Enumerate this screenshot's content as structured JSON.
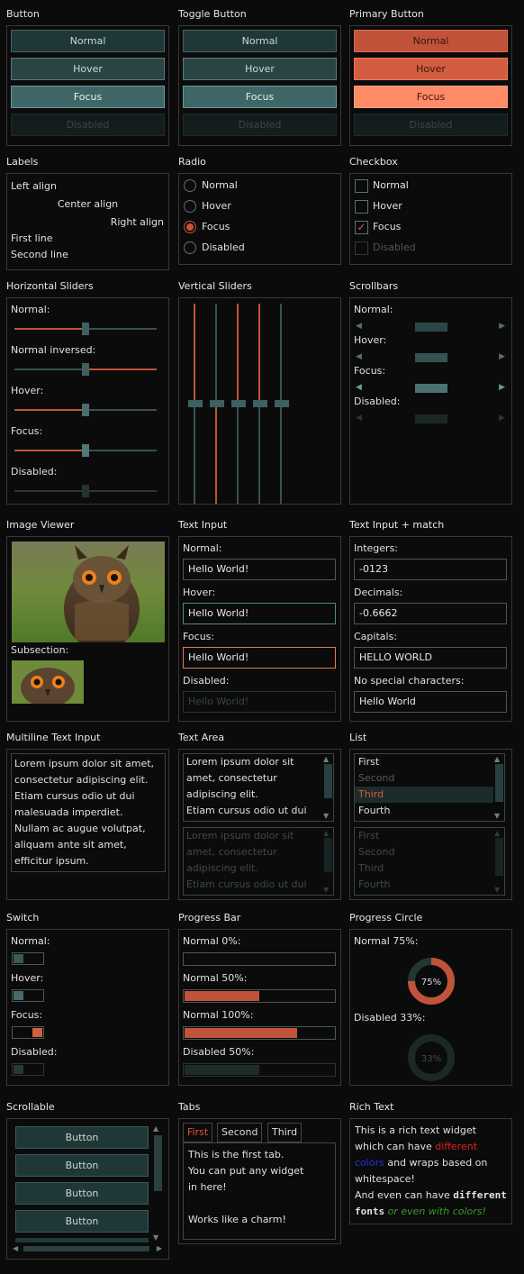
{
  "sections": {
    "button": "Button",
    "toggle_button": "Toggle Button",
    "primary_button": "Primary Button",
    "labels": "Labels",
    "radio": "Radio",
    "checkbox": "Checkbox",
    "hsliders": "Horizontal Sliders",
    "vsliders": "Vertical Sliders",
    "scrollbars": "Scrollbars",
    "image_viewer": "Image Viewer",
    "text_input": "Text Input",
    "text_input_match": "Text Input + match",
    "multiline": "Multiline Text Input",
    "text_area": "Text Area",
    "list": "List",
    "switch": "Switch",
    "progress_bar": "Progress Bar",
    "progress_circle": "Progress Circle",
    "scrollable": "Scrollable",
    "tabs": "Tabs",
    "rich_text": "Rich Text"
  },
  "button_states": [
    "Normal",
    "Hover",
    "Focus",
    "Disabled"
  ],
  "labels": {
    "left": "Left align",
    "center": "Center align",
    "right": "Right align",
    "first": "First line",
    "second": "Second line"
  },
  "radio": [
    "Normal",
    "Hover",
    "Focus",
    "Disabled"
  ],
  "checkbox": [
    "Normal",
    "Hover",
    "Focus",
    "Disabled"
  ],
  "hsliders": [
    {
      "label": "Normal:",
      "value": 0.5,
      "inversed": false
    },
    {
      "label": "Normal inversed:",
      "value": 0.5,
      "inversed": true
    },
    {
      "label": "Hover:",
      "value": 0.5,
      "inversed": false
    },
    {
      "label": "Focus:",
      "value": 0.5,
      "inversed": false
    },
    {
      "label": "Disabled:",
      "value": 0.5,
      "inversed": false
    }
  ],
  "vsliders": [
    {
      "value": 0.5,
      "inversed": false
    },
    {
      "value": 0.5,
      "inversed": true
    },
    {
      "value": 0.5,
      "inversed": false
    },
    {
      "value": 0.5,
      "inversed": false
    },
    {
      "value": 0.5,
      "inversed": false
    }
  ],
  "scrollbars": [
    "Normal:",
    "Hover:",
    "Focus:",
    "Disabled:"
  ],
  "image_viewer": {
    "subsection": "Subsection:"
  },
  "text_input": {
    "labels": [
      "Normal:",
      "Hover:",
      "Focus:",
      "Disabled:"
    ],
    "value": "Hello World!"
  },
  "text_input_match": {
    "labels": [
      "Integers:",
      "Decimals:",
      "Capitals:",
      "No special characters:"
    ],
    "values": [
      "-0123",
      "-0.6662",
      "HELLO WORLD",
      "Hello World"
    ]
  },
  "multiline_lines": [
    "Lorem ipsum dolor sit amet,",
    "consectetur adipiscing elit.",
    "Etiam cursus odio ut dui",
    "malesuada imperdiet.",
    "Nullam ac augue volutpat,",
    "aliquam ante sit amet,",
    "efficitur ipsum."
  ],
  "text_area_lines": [
    "Lorem ipsum dolor sit",
    "amet, consectetur",
    "adipiscing elit.",
    "Etiam cursus odio ut dui"
  ],
  "list_items": [
    "First",
    "Second",
    "Third",
    "Fourth"
  ],
  "switch_labels": [
    "Normal:",
    "Hover:",
    "Focus:",
    "Disabled:"
  ],
  "progress_bar": [
    {
      "label": "Normal 0%:",
      "value": 0.0
    },
    {
      "label": "Normal 50%:",
      "value": 0.5
    },
    {
      "label": "Normal 100%:",
      "value": 0.75
    },
    {
      "label": "Disabled 50%:",
      "value": 0.5
    }
  ],
  "progress_circle": [
    {
      "label": "Normal 75%:",
      "text": "75%",
      "value": 0.75
    },
    {
      "label": "Disabled 33%:",
      "text": "33%",
      "value": 0.33
    }
  ],
  "scrollable_buttons": [
    "Button",
    "Button",
    "Button",
    "Button"
  ],
  "tabs": {
    "names": [
      "First",
      "Second",
      "Third"
    ],
    "content": [
      "This is the first tab.",
      "You can put any widget",
      "in here!",
      "",
      "Works like a charm!"
    ]
  },
  "rich_text": {
    "l1": "This is a rich text widget",
    "l2a": "which can have ",
    "l2b": "different",
    "l3a": "colors",
    "l3b": " and wraps based on",
    "l4": "whitespace!",
    "l5a": "And even can have ",
    "l5b": "different",
    "l6a": "fonts",
    "l6b": " or even with colors!"
  },
  "colors": {
    "accent": "#c0533a",
    "teal": "#203737"
  }
}
